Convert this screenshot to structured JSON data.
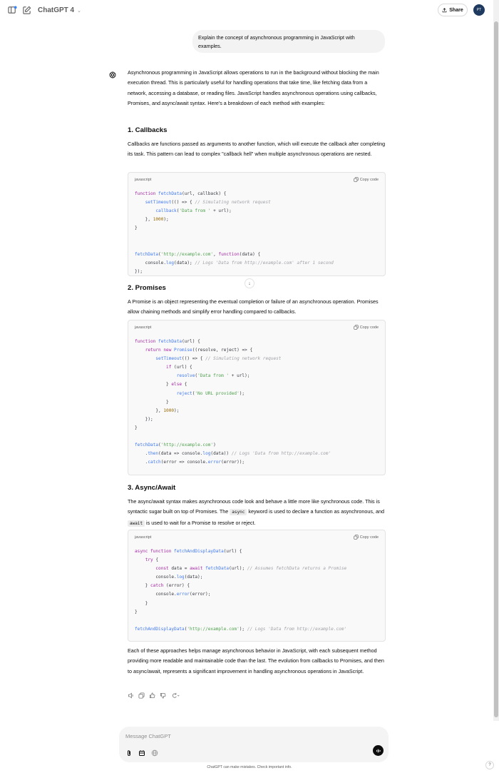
{
  "header": {
    "model_name": "ChatGPT 4",
    "share_label": "Share",
    "avatar_initials": "PT"
  },
  "user_message": "Explain the concept of asynchronous programming in JavaScript with examples.",
  "assistant": {
    "intro": "Asynchronous programming in JavaScript allows operations to run in the background without blocking the main execution thread. This is particularly useful for handling operations that take time, like fetching data from a network, accessing a database, or reading files. JavaScript handles asynchronous operations using callbacks, Promises, and async/await syntax. Here's a breakdown of each method with examples:",
    "sections": [
      {
        "heading": "1. Callbacks",
        "text": "Callbacks are functions passed as arguments to another function, which will execute the callback after completing its task. This pattern can lead to complex \"callback hell\" when multiple asynchronous operations are nested.",
        "code_lang": "javascript",
        "copy_label": "Copy code"
      },
      {
        "heading": "2. Promises",
        "text": "A Promise is an object representing the eventual completion or failure of an asynchronous operation. Promises allow chaining methods and simplify error handling compared to callbacks.",
        "code_lang": "javascript",
        "copy_label": "Copy code"
      },
      {
        "heading": "3. Async/Await",
        "text_1": "The async/await syntax makes asynchronous code look and behave a little more like synchronous code. This is syntactic sugar built on top of Promises. The ",
        "kw_async": "async",
        "text_2": " keyword is used to declare a function as asynchronous, and ",
        "kw_await": "await",
        "text_3": " is used to wait for a Promise to resolve or reject.",
        "code_lang": "javascript",
        "copy_label": "Copy code"
      }
    ],
    "conclusion": "Each of these approaches helps manage asynchronous behavior in JavaScript, with each subsequent method providing more readable and maintainable code than the last. The evolution from callbacks to Promises, and then to async/await, represents a significant improvement in handling asynchronous operations in JavaScript."
  },
  "composer": {
    "placeholder": "Message ChatGPT"
  },
  "footer": "ChatGPT can make mistakes. Check important info.",
  "help_label": "?"
}
